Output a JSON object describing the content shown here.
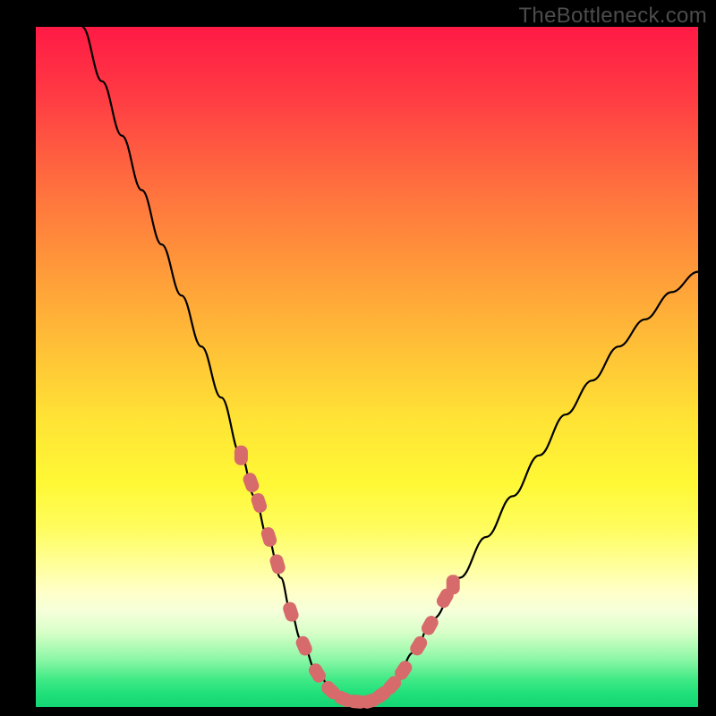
{
  "watermark": "TheBottleneck.com",
  "chart_data": {
    "type": "line",
    "title": "",
    "xlabel": "",
    "ylabel": "",
    "xlim": [
      0,
      100
    ],
    "ylim": [
      0,
      100
    ],
    "grid": false,
    "series": [
      {
        "name": "bottleneck-curve",
        "x": [
          7,
          10,
          13,
          16,
          19,
          22,
          25,
          28,
          31,
          33,
          35,
          37,
          38.5,
          40,
          42.5,
          45,
          47,
          49,
          51,
          54,
          57,
          60,
          64,
          68,
          72,
          76,
          80,
          84,
          88,
          92,
          96,
          100
        ],
        "values": [
          100,
          92,
          84,
          76,
          68,
          60.5,
          53,
          45.5,
          37,
          31,
          25,
          19,
          14,
          10,
          5,
          2,
          1,
          0.7,
          1,
          3,
          8,
          13,
          19,
          25,
          31,
          37,
          43,
          48,
          53,
          57,
          61,
          64
        ]
      }
    ],
    "markers": {
      "name": "data-dots",
      "x": [
        31,
        32.5,
        33.7,
        35.2,
        36.5,
        38.5,
        40.5,
        42.5,
        44.5,
        46.5,
        48.5,
        50.5,
        52.2,
        53.8,
        55.5,
        57.8,
        59.5,
        61.8,
        63
      ],
      "values": [
        37,
        33,
        30,
        25,
        21,
        14,
        9,
        5,
        2.5,
        1.2,
        0.8,
        0.9,
        1.8,
        3.2,
        5.4,
        9,
        12,
        16,
        18
      ],
      "color": "#d76b6b"
    }
  }
}
